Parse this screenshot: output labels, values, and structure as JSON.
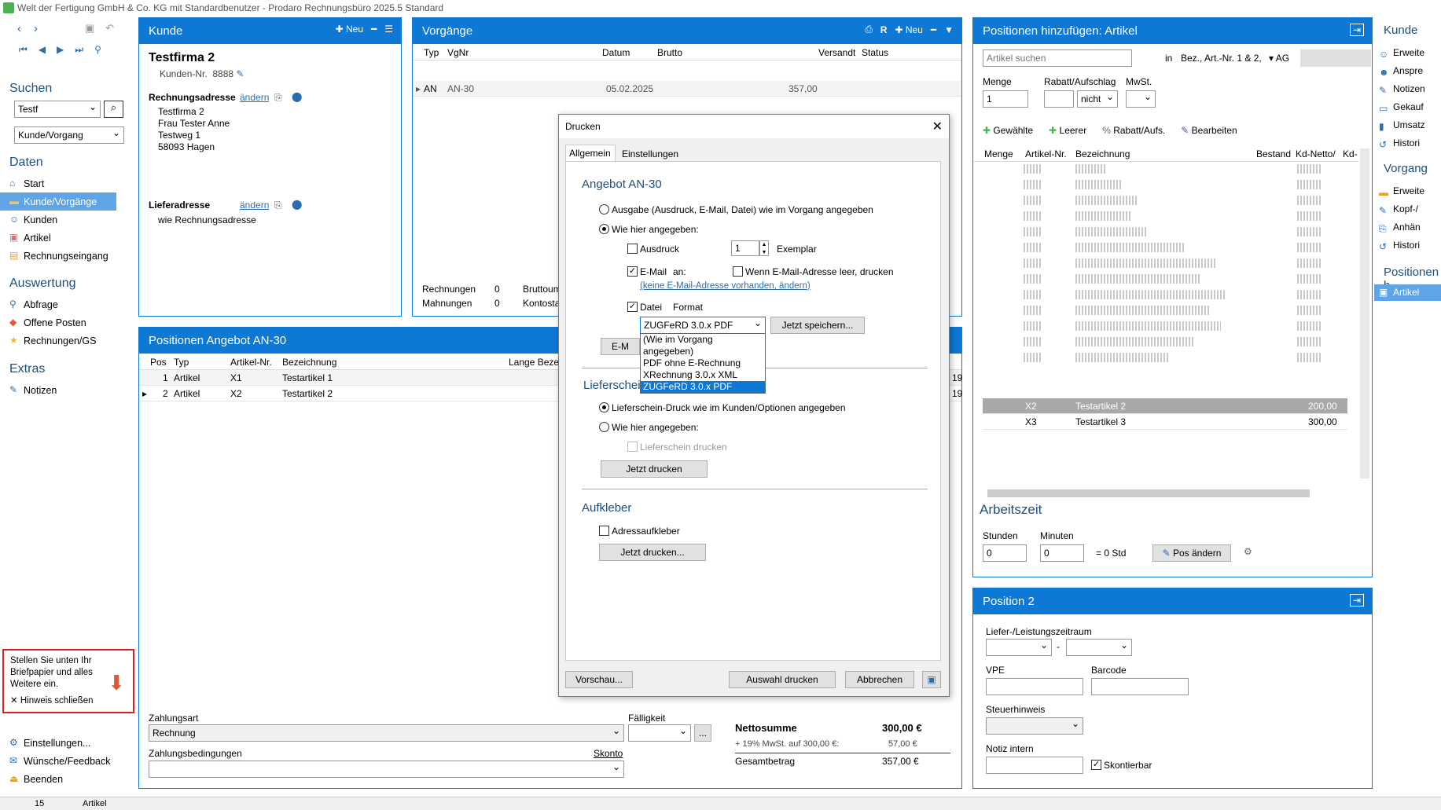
{
  "window": {
    "title": "Welt der Fertigung GmbH & Co. KG mit Standardbenutzer  -  Prodaro Rechnungsbüro 2025.5 Standard"
  },
  "sidebar": {
    "search_title": "Suchen",
    "search_value": "Testf",
    "search_mode": "Kunde/Vorgang",
    "daten_title": "Daten",
    "daten_items": [
      "Start",
      "Kunde/Vorgänge",
      "Kunden",
      "Artikel",
      "Rechnungseingang"
    ],
    "auswertung_title": "Auswertung",
    "auswertung_items": [
      "Abfrage",
      "Offene Posten",
      "Rechnungen/GS"
    ],
    "extras_title": "Extras",
    "extras_items": [
      "Notizen"
    ],
    "hint": "Stellen Sie unten Ihr Briefpapier und alles Weitere ein.",
    "hint_close": "Hinweis schließen",
    "bottom_items": [
      "Einstellungen...",
      "Wünsche/Feedback",
      "Beenden"
    ]
  },
  "kunde": {
    "header": "Kunde",
    "new_label": "Neu",
    "name": "Testfirma 2",
    "nr_label": "Kunden-Nr.",
    "nr": "8888",
    "rechnung_label": "Rechnungsadresse",
    "aendern": "ändern",
    "address": [
      "Testfirma 2",
      "Frau Tester Anne",
      "Testweg 1",
      "58093 Hagen"
    ],
    "liefer_label": "Lieferadresse",
    "liefer_value": "wie Rechnungsadresse"
  },
  "vorgaenge": {
    "header": "Vorgänge",
    "new_label": "Neu",
    "cols": [
      "Typ",
      "VgNr",
      "Datum",
      "Brutto",
      "Versandt",
      "Status"
    ],
    "row": {
      "typ": "AN",
      "vgnr": "AN-30",
      "datum": "05.02.2025",
      "brutto": "357,00"
    },
    "stats": [
      {
        "label": "Rechnungen",
        "value": "0",
        "extra": "Bruttoum"
      },
      {
        "label": "Mahnungen",
        "value": "0",
        "extra": "Kontosta"
      }
    ]
  },
  "positionen": {
    "header": "Positionen Angebot AN-30",
    "cols": [
      "Pos",
      "Typ",
      "Artikel-Nr.",
      "Bezeichnung",
      "Lange Bezei"
    ],
    "rows": [
      {
        "pos": "1",
        "typ": "Artikel",
        "nr": "X1",
        "bez": "Testartikel 1",
        "tail": "19"
      },
      {
        "pos": "2",
        "typ": "Artikel",
        "nr": "X2",
        "bez": "Testartikel 2",
        "tail": "19"
      }
    ],
    "zahlungsart_label": "Zahlungsart",
    "zahlungsart": "Rechnung",
    "faelligkeit_label": "Fälligkeit",
    "zb_label": "Zahlungsbedingungen",
    "skonto": "Skonto",
    "netto_label": "Nettosumme",
    "netto": "300,00  €",
    "mwst_label": "+ 19% MwSt. auf 300,00 €:",
    "mwst": "57,00  €",
    "gesamt_label": "Gesamtbetrag",
    "gesamt": "357,00  €"
  },
  "artikel_panel": {
    "header": "Positionen hinzufügen: Artikel",
    "search_placeholder": "Artikel suchen",
    "in_label": "in",
    "in_value": "Bez., Art.-Nr. 1 & 2,",
    "ag": "AG",
    "menge_label": "Menge",
    "menge": "1",
    "rabatt_label": "Rabatt/Aufschlag",
    "rabatt_mode": "nicht",
    "mwst_label": "MwSt.",
    "actions": [
      "Gewählte",
      "Leerer",
      "Rabatt/Aufs.",
      "Bearbeiten"
    ],
    "cols": [
      "Menge",
      "Artikel-Nr.",
      "Bezeichnung",
      "Bestand",
      "Kd-Netto/",
      "Kd-"
    ],
    "rows": [
      {
        "nr": "X2",
        "bez": "Testartikel 2",
        "preis": "200,00"
      },
      {
        "nr": "X3",
        "bez": "Testartikel 3",
        "preis": "300,00"
      }
    ],
    "arbeitszeit": "Arbeitszeit",
    "stunden_label": "Stunden",
    "stunden": "0",
    "minuten_label": "Minuten",
    "minuten": "0",
    "std": "= 0 Std",
    "pos_aendern": "Pos ändern"
  },
  "position2": {
    "header": "Position 2",
    "zeitraum_label": "Liefer-/Leistungszeitraum",
    "vpe_label": "VPE",
    "barcode_label": "Barcode",
    "steuer_label": "Steuerhinweis",
    "notiz_label": "Notiz intern",
    "skontierbar": "Skontierbar"
  },
  "right_nav": {
    "kunde_title": "Kunde",
    "kunde_items": [
      "Erweite",
      "Anspre",
      "Notizen",
      "Gekauf",
      "Umsatz",
      "Histori"
    ],
    "vorgang_title": "Vorgang",
    "vorgang_items": [
      "Erweite",
      "Kopf-/",
      "Anhän",
      "Histori"
    ],
    "positionen_title": "Positionen h",
    "positionen_items": [
      "Artikel"
    ]
  },
  "statusbar": {
    "count": "15",
    "text": "Artikel"
  },
  "dialog": {
    "title": "Drucken",
    "tabs": [
      "Allgemein",
      "Einstellungen"
    ],
    "angebot_title": "Angebot AN-30",
    "opt1": "Ausgabe (Ausdruck, E-Mail, Datei) wie im Vorgang angegeben",
    "opt2": "Wie hier angegeben:",
    "ausdruck": "Ausdruck",
    "exemplar_value": "1",
    "exemplar": "Exemplar",
    "email": "E-Mail",
    "an": "an:",
    "wenn_leer": "Wenn E-Mail-Adresse leer, drucken",
    "email_link": "(keine E-Mail-Adresse vorhanden, ändern)",
    "datei": "Datei",
    "format_label": "Format",
    "format_value": "ZUGFeRD 3.0.x PDF",
    "jetzt_speichern": "Jetzt speichern...",
    "format_options": [
      "(Wie im Vorgang angegeben)",
      "PDF ohne E-Rechnung",
      "XRechnung 3.0.x XML",
      "ZUGFeRD 3.0.x PDF"
    ],
    "email_btn": "E-M",
    "lieferschein_title": "Lieferschein",
    "ls_opt1": "Lieferschein-Druck wie im Kunden/Optionen angegeben",
    "ls_opt2": "Wie hier angegeben:",
    "ls_drucken": "Lieferschein drucken",
    "jetzt_drucken": "Jetzt drucken",
    "aufkleber_title": "Aufkleber",
    "adressaufkleber": "Adressaufkleber",
    "jetzt_drucken2": "Jetzt drucken...",
    "vorschau": "Vorschau...",
    "auswahl": "Auswahl drucken",
    "abbrechen": "Abbrechen"
  },
  "colors": {
    "accent": "#0e78d5",
    "selected": "#5ea4e6",
    "hint_border": "#e02020"
  }
}
